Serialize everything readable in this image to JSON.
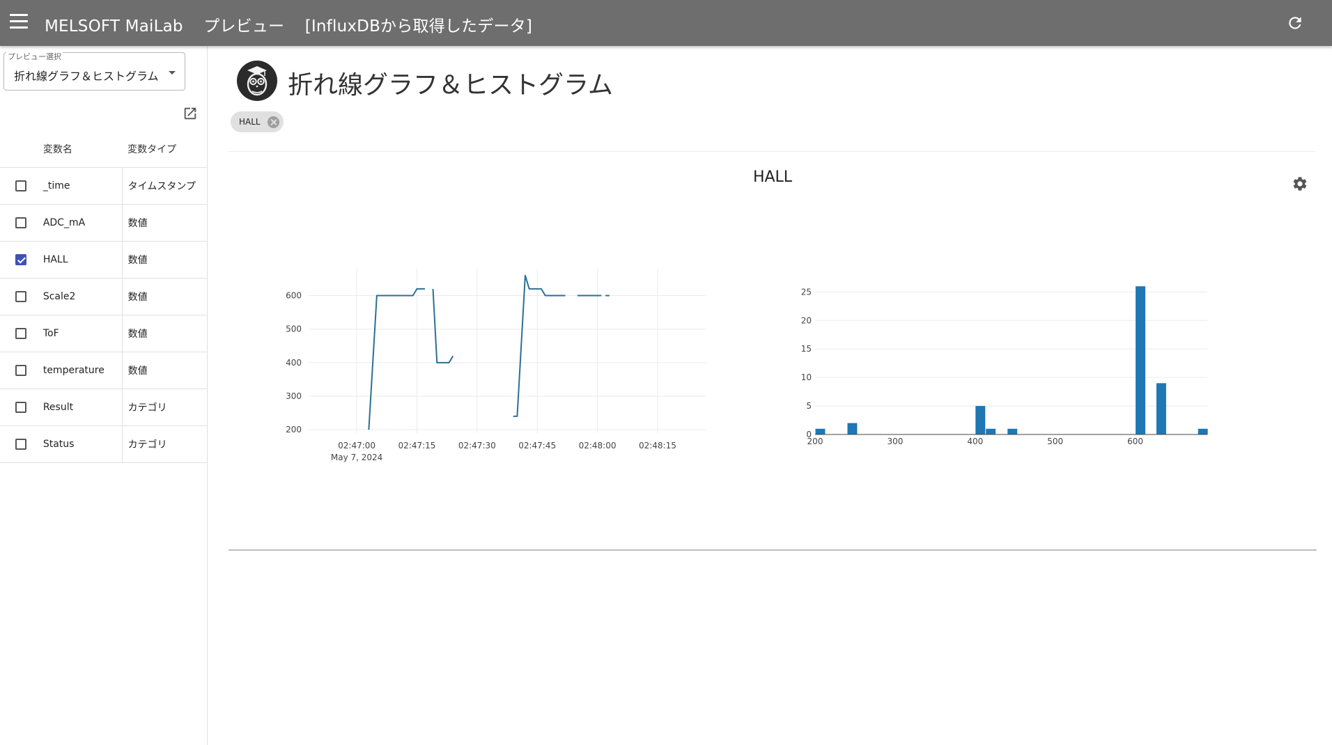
{
  "appbar": {
    "app_name": "MELSOFT MaiLab",
    "mode": "プレビュー",
    "source": "[InfluxDBから取得したデータ]"
  },
  "sidebar": {
    "select_legend": "プレビュー選択",
    "select_value": "折れ線グラフ＆ヒストグラム",
    "table_headers": {
      "name": "変数名",
      "type": "変数タイプ"
    },
    "variables": [
      {
        "name": "_time",
        "type": "タイムスタンプ",
        "checked": false
      },
      {
        "name": "ADC_mA",
        "type": "数値",
        "checked": false
      },
      {
        "name": "HALL",
        "type": "数値",
        "checked": true
      },
      {
        "name": "Scale2",
        "type": "数値",
        "checked": false
      },
      {
        "name": "ToF",
        "type": "数値",
        "checked": false
      },
      {
        "name": "temperature",
        "type": "数値",
        "checked": false
      },
      {
        "name": "Result",
        "type": "カテゴリ",
        "checked": false
      },
      {
        "name": "Status",
        "type": "カテゴリ",
        "checked": false
      }
    ]
  },
  "main": {
    "title": "折れ線グラフ＆ヒストグラム",
    "chip_label": "HALL",
    "chart_title": "HALL"
  },
  "colors": {
    "appbar": "#6e6e6e",
    "series": "#2a6f97",
    "bar": "#1f77b4",
    "checkbox": "#3f51b5"
  },
  "chart_data": [
    {
      "type": "line",
      "title": "HALL",
      "x_ticks": [
        "02:47:00",
        "02:47:15",
        "02:47:30",
        "02:47:45",
        "02:48:00",
        "02:48:15"
      ],
      "x_date_label": "May 7, 2024",
      "y_ticks": [
        200,
        300,
        400,
        500,
        600
      ],
      "ylim": [
        190,
        680
      ],
      "segments": [
        [
          [
            3,
            200
          ],
          [
            5,
            600
          ],
          [
            14,
            600
          ],
          [
            15,
            620
          ],
          [
            17,
            620
          ]
        ],
        [
          [
            19,
            620
          ],
          [
            20,
            400
          ],
          [
            23,
            400
          ],
          [
            24,
            420
          ]
        ],
        [
          [
            39,
            240
          ],
          [
            40,
            240
          ],
          [
            42,
            660
          ],
          [
            43,
            620
          ],
          [
            46,
            620
          ],
          [
            47,
            600
          ],
          [
            52,
            600
          ]
        ],
        [
          [
            55,
            600
          ],
          [
            61,
            600
          ]
        ],
        [
          [
            62,
            600
          ],
          [
            63,
            600
          ]
        ]
      ]
    },
    {
      "type": "bar",
      "x_ticks": [
        200,
        300,
        400,
        500,
        600
      ],
      "y_ticks": [
        0,
        5,
        10,
        15,
        20,
        25
      ],
      "xlim": [
        200,
        690
      ],
      "ylim": [
        0,
        27
      ],
      "bin_width": 13,
      "bins": [
        {
          "x": 200,
          "count": 1
        },
        {
          "x": 240,
          "count": 2
        },
        {
          "x": 400,
          "count": 5
        },
        {
          "x": 413,
          "count": 1
        },
        {
          "x": 440,
          "count": 1
        },
        {
          "x": 600,
          "count": 26
        },
        {
          "x": 626,
          "count": 9
        },
        {
          "x": 678,
          "count": 1
        }
      ]
    }
  ]
}
